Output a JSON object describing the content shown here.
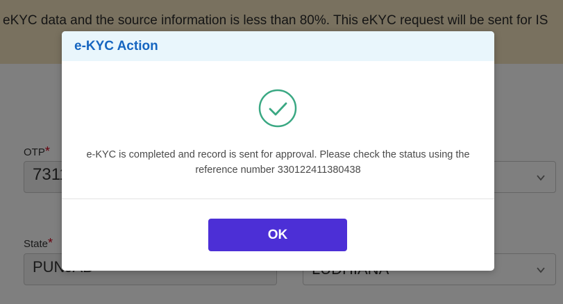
{
  "banner": {
    "text": "eKYC data and the source information is less than 80%. This eKYC request will be sent for IS"
  },
  "form": {
    "otp_label": "OTP",
    "otp_value": "7311",
    "state_label": "State",
    "state_value": "PUNJAB",
    "district_value": "LUDHIANA",
    "required_mark": "*"
  },
  "modal": {
    "title": "e-KYC Action",
    "message": "e-KYC is completed and record is sent for approval. Please check the status using the reference number 330122411380438",
    "ok_label": "OK"
  },
  "colors": {
    "title": "#1565c0",
    "success": "#3aa883",
    "button": "#4c2fd6"
  }
}
